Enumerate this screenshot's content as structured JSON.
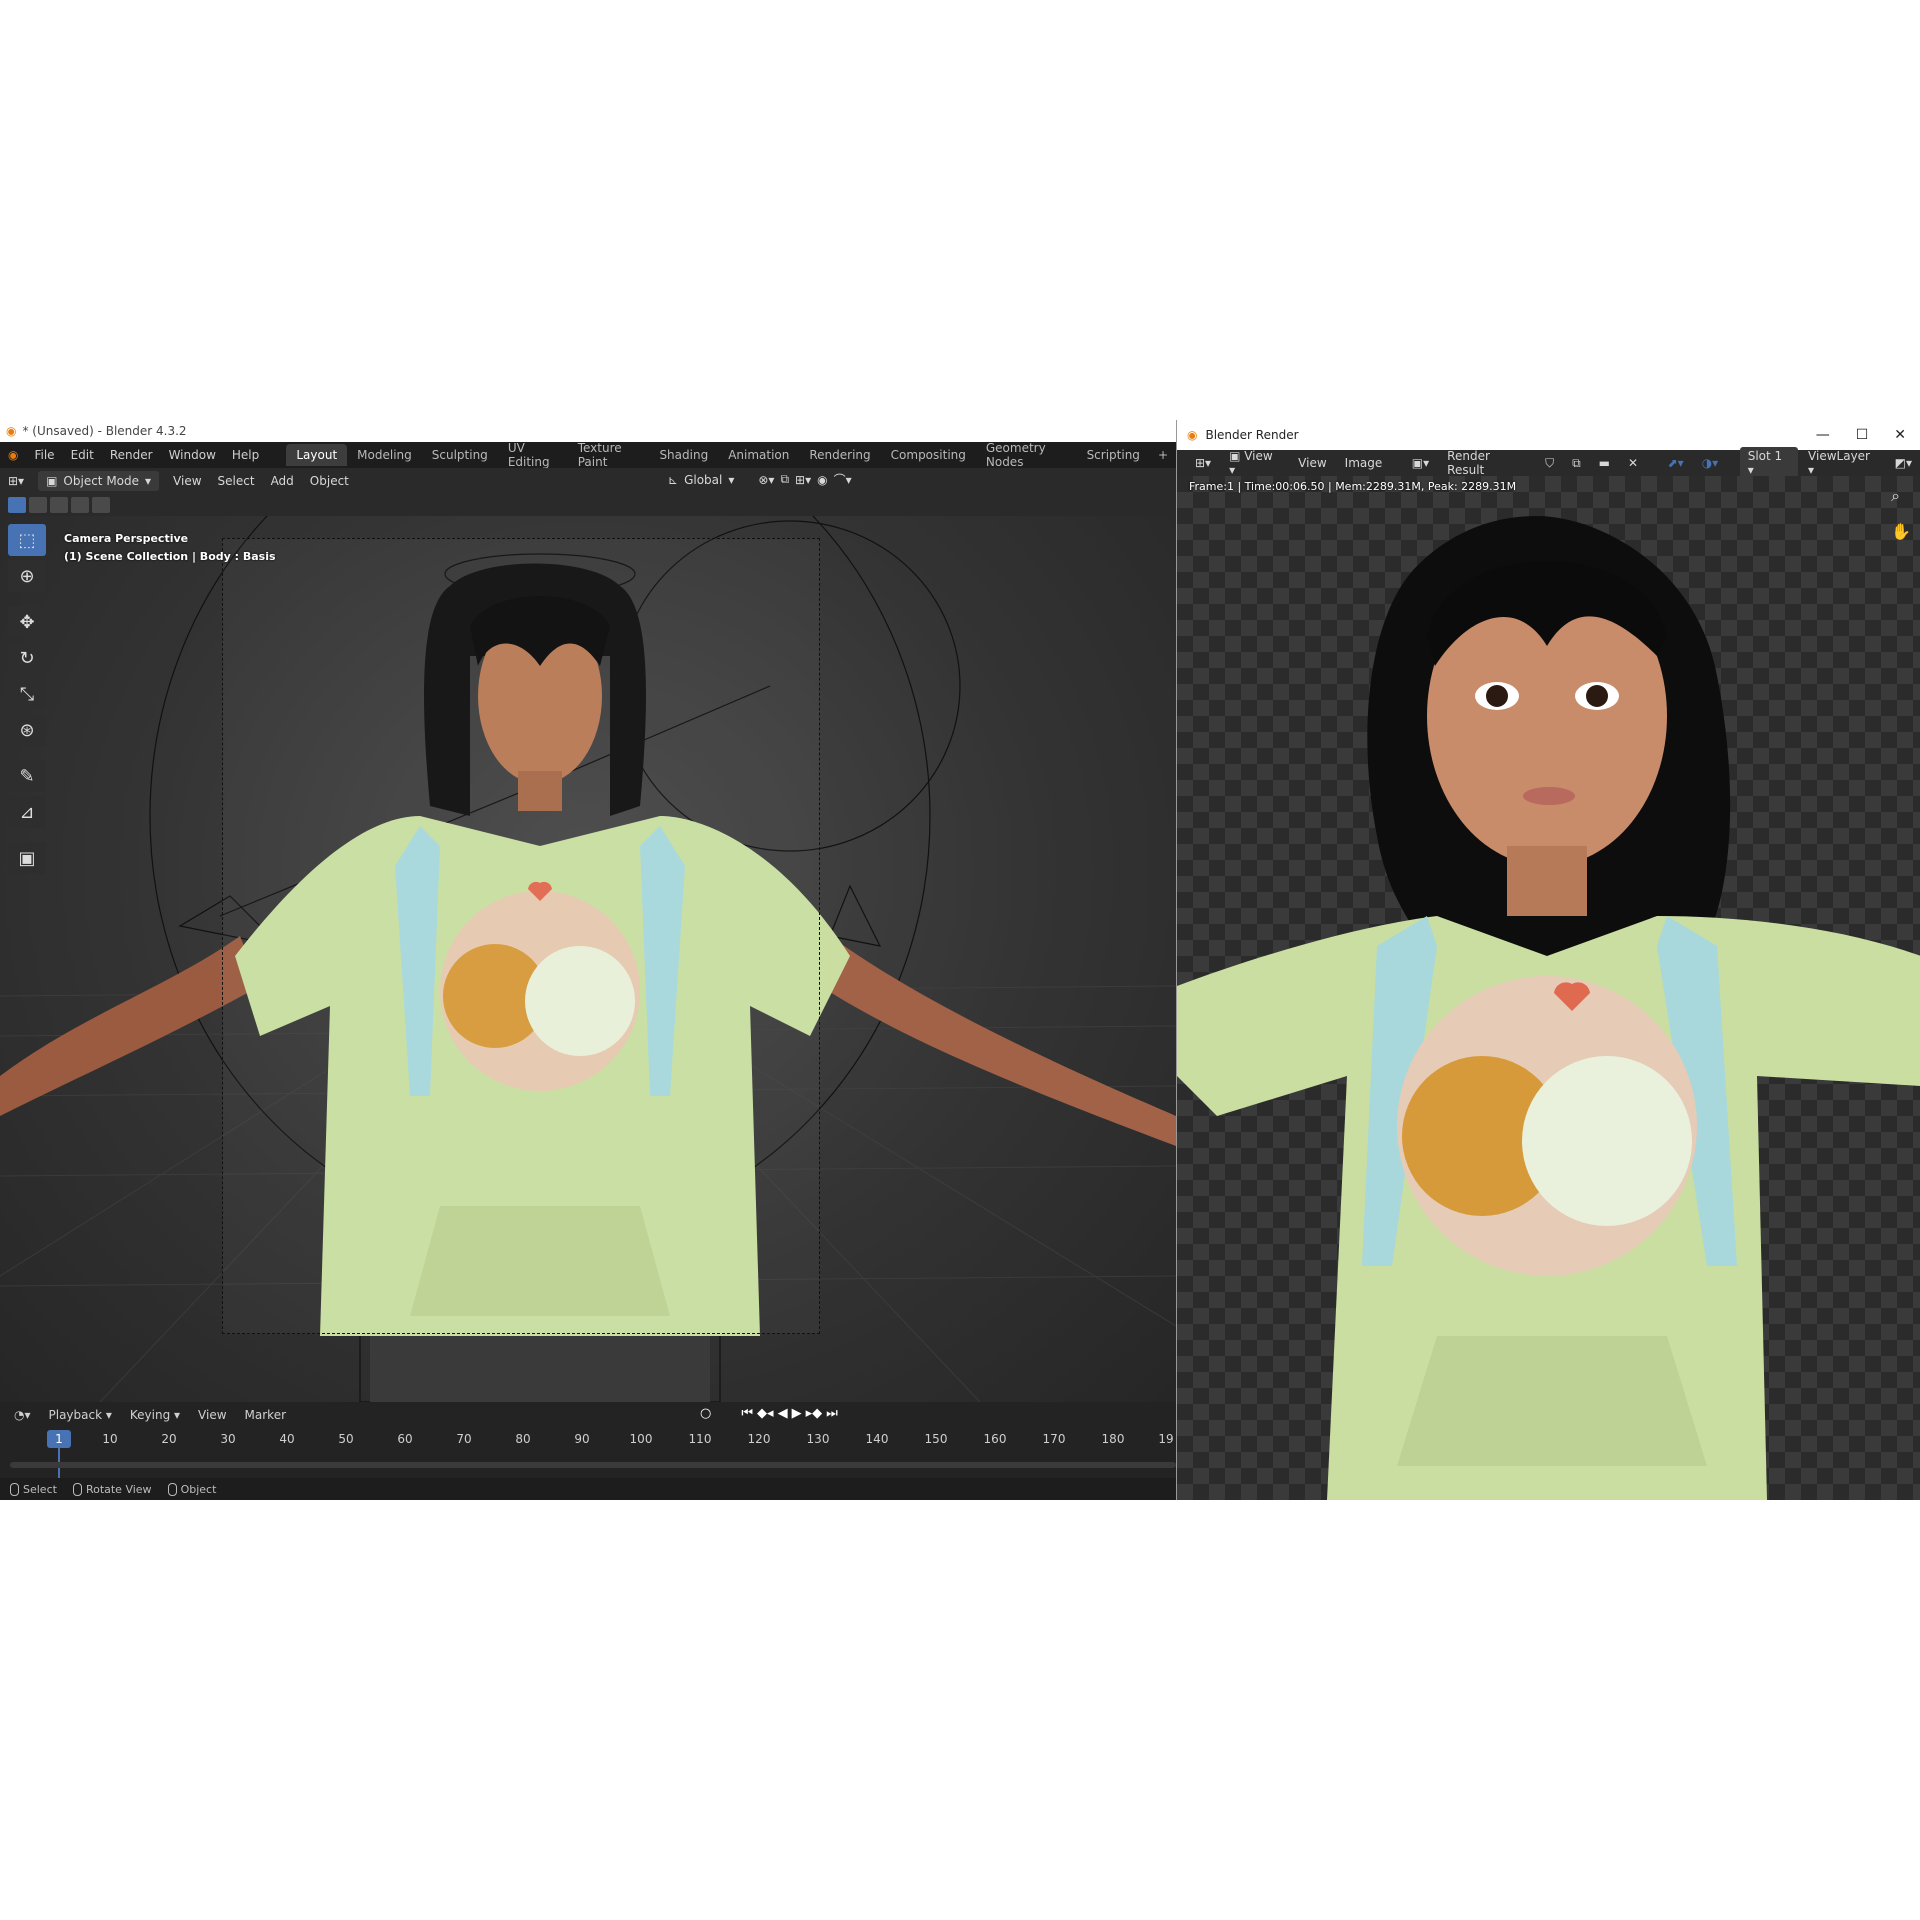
{
  "main_window": {
    "title": "* (Unsaved) - Blender 4.3.2",
    "menus": [
      "File",
      "Edit",
      "Render",
      "Window",
      "Help"
    ],
    "workspaces": [
      "Layout",
      "Modeling",
      "Sculpting",
      "UV Editing",
      "Texture Paint",
      "Shading",
      "Animation",
      "Rendering",
      "Compositing",
      "Geometry Nodes",
      "Scripting"
    ],
    "active_workspace": "Layout",
    "add_workspace": "+"
  },
  "viewport_header": {
    "mode": "Object Mode",
    "menus": [
      "View",
      "Select",
      "Add",
      "Object"
    ],
    "orientation": "Global"
  },
  "viewport": {
    "camera_label": "Camera Perspective",
    "collection_label": "(1) Scene Collection | Body : Basis"
  },
  "timeline": {
    "menus": [
      "Playback",
      "Keying",
      "View",
      "Marker"
    ],
    "current_frame": "1",
    "ticks": [
      "10",
      "20",
      "30",
      "40",
      "50",
      "60",
      "70",
      "80",
      "90",
      "100",
      "110",
      "120",
      "130",
      "140",
      "150",
      "160",
      "170",
      "180",
      "19"
    ]
  },
  "statusbar": {
    "items": [
      "Select",
      "Rotate View",
      "Object"
    ]
  },
  "render_window": {
    "title": "Blender Render",
    "view_menu": "View",
    "menus": [
      "View",
      "Image"
    ],
    "image_name": "Render Result",
    "slot": "Slot 1",
    "view_layer": "ViewLayer",
    "info": "Frame:1 | Time:00:06.50 | Mem:2289.31M, Peak: 2289.31M"
  },
  "colors": {
    "accent": "#4772b3",
    "bg_dark": "#1d1d1d",
    "shirt": "#c9dea0",
    "backpack": "#a8d8dc"
  }
}
